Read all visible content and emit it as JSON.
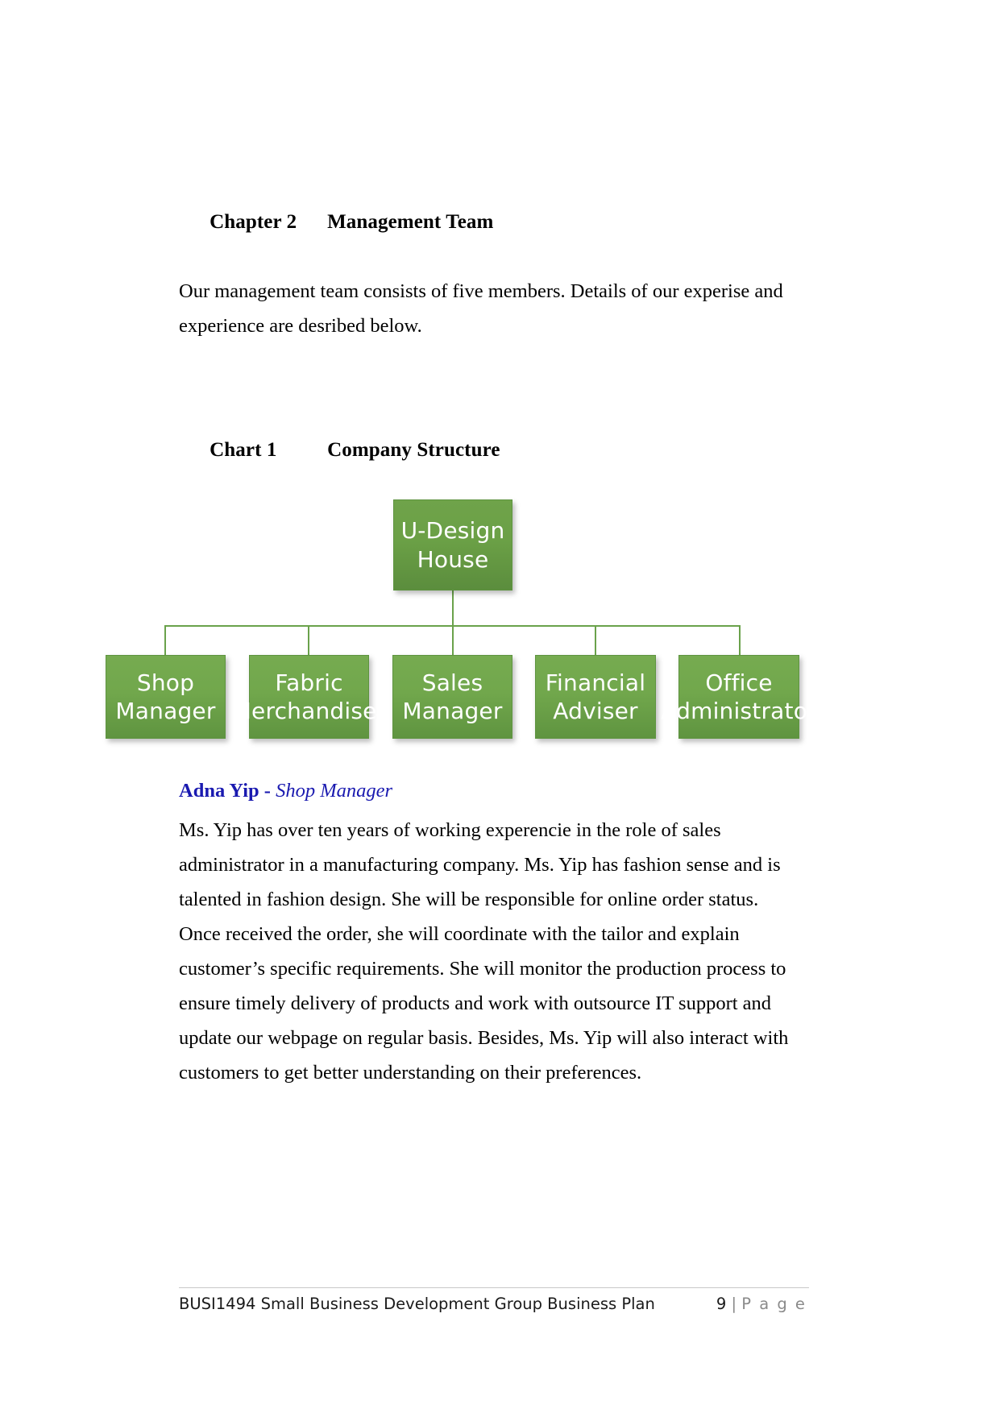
{
  "document": {
    "chapter_heading": {
      "label": "Chapter 2",
      "title": "Management Team"
    },
    "intro_paragraph": "Our management team consists of five members.  Details of our experise and experience are desribed below.",
    "chart_heading": {
      "label": "Chart 1",
      "title": "Company Structure"
    },
    "person": {
      "name": "Adna Yip",
      "separator": " - ",
      "role": "Shop Manager",
      "bio": "Ms. Yip has over ten years of working experencie in the role of sales administrator in a manufacturing company. Ms. Yip has fashion sense and is talented in fashion design. She will be responsible for online order status. Once received the order, she will coordinate with the tailor and explain customer’s specific requirements. She will monitor the production process to ensure timely delivery of products and work with outsource IT support and update our webpage on regular basis. Besides, Ms. Yip will also interact with customers to get better understanding on their preferences."
    },
    "footer": {
      "left_text": "BUSI1494 Small Business Development Group Business Plan",
      "page_number": "9",
      "page_pipe": " | ",
      "page_word": "P a g e"
    }
  },
  "chart_data": {
    "type": "diagram",
    "title": "Company Structure",
    "layout": "organization-chart",
    "node_fill": "#70ad47",
    "node_text_color": "#ffffff",
    "connector_color": "#6aa24b",
    "root": {
      "label": "U-Design\nHouse"
    },
    "children": [
      {
        "label": "Shop\nManager"
      },
      {
        "label": "Fabric\nMerchandiser"
      },
      {
        "label": "Sales\nManager"
      },
      {
        "label": "Financial\nAdviser"
      },
      {
        "label": "Office\nAdministrator"
      }
    ]
  }
}
